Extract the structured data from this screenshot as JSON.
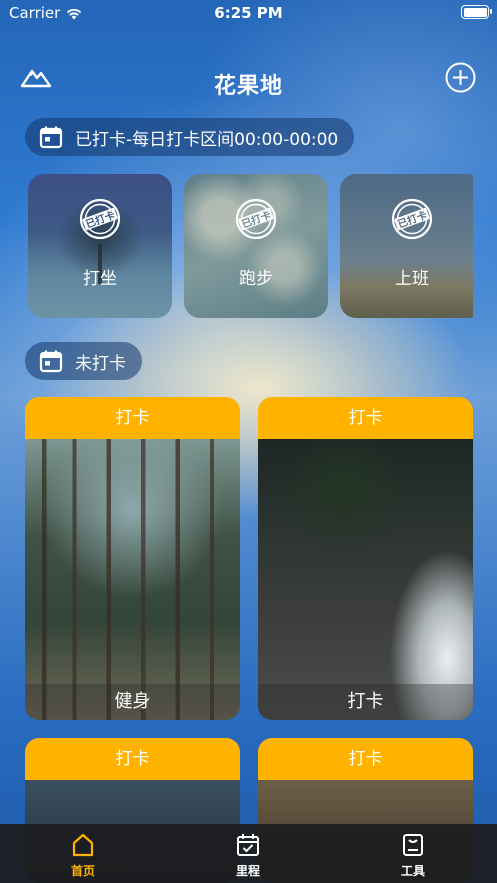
{
  "status_bar": {
    "carrier": "Carrier",
    "time": "6:25 PM"
  },
  "nav": {
    "title": "花果地"
  },
  "checked_section": {
    "label": "已打卡-每日打卡区间00:00-00:00"
  },
  "checked_items": [
    {
      "label": "打坐",
      "stamp": "已打卡"
    },
    {
      "label": "跑步",
      "stamp": "已打卡"
    },
    {
      "label": "上班",
      "stamp": "已打卡"
    }
  ],
  "unchecked_section": {
    "label": "未打卡"
  },
  "unchecked_items": [
    {
      "button": "打卡",
      "caption": "健身"
    },
    {
      "button": "打卡",
      "caption": "打卡"
    },
    {
      "button": "打卡"
    },
    {
      "button": "打卡"
    }
  ],
  "tabbar": {
    "items": [
      {
        "label": "首页",
        "icon": "home-icon",
        "active": true
      },
      {
        "label": "里程",
        "icon": "calendar-check-icon",
        "active": false
      },
      {
        "label": "工具",
        "icon": "toolbox-icon",
        "active": false
      }
    ]
  },
  "colors": {
    "accent": "#ffb300",
    "tab_active": "#ffb300",
    "tabbar_bg": "#1c1c1e"
  }
}
